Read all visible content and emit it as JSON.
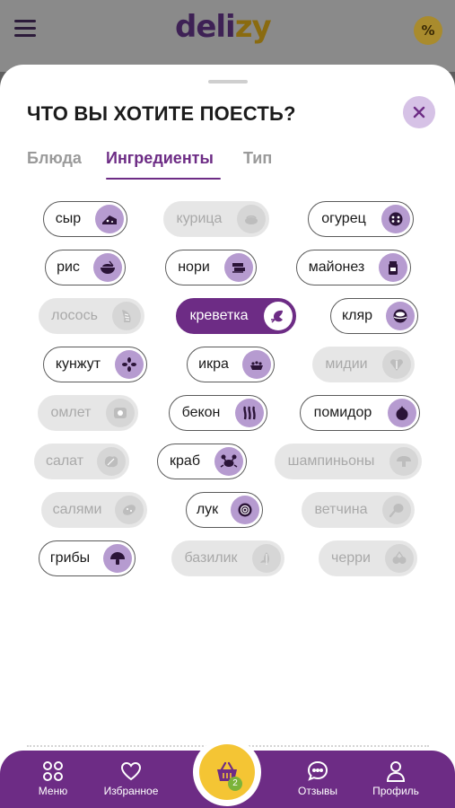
{
  "app": {
    "logo_part1": "deli",
    "logo_part2": "zy",
    "promo_badge": "%"
  },
  "sheet": {
    "title": "ЧТО ВЫ ХОТИТЕ ПОЕСТЬ?",
    "tabs": [
      {
        "label": "Блюда",
        "active": false
      },
      {
        "label": "Ингредиенты",
        "active": true
      },
      {
        "label": "Тип",
        "active": false
      }
    ],
    "ingredients": [
      {
        "label": "сыр",
        "state": "available",
        "icon": "cheese-icon"
      },
      {
        "label": "курица",
        "state": "disabled",
        "icon": "chicken-icon"
      },
      {
        "label": "огурец",
        "state": "available",
        "icon": "cucumber-icon"
      },
      {
        "label": "рис",
        "state": "available",
        "icon": "rice-bowl-icon"
      },
      {
        "label": "нори",
        "state": "available",
        "icon": "nori-icon"
      },
      {
        "label": "майонез",
        "state": "available",
        "icon": "mayo-jar-icon"
      },
      {
        "label": "лосось",
        "state": "disabled",
        "icon": "salmon-icon"
      },
      {
        "label": "креветка",
        "state": "selected",
        "icon": "shrimp-icon"
      },
      {
        "label": "кляр",
        "state": "available",
        "icon": "batter-icon"
      },
      {
        "label": "кунжут",
        "state": "available",
        "icon": "sesame-icon"
      },
      {
        "label": "икра",
        "state": "available",
        "icon": "caviar-icon"
      },
      {
        "label": "мидии",
        "state": "disabled",
        "icon": "mussels-icon"
      },
      {
        "label": "омлет",
        "state": "disabled",
        "icon": "omelette-icon"
      },
      {
        "label": "бекон",
        "state": "available",
        "icon": "bacon-icon"
      },
      {
        "label": "помидор",
        "state": "available",
        "icon": "tomato-icon"
      },
      {
        "label": "салат",
        "state": "disabled",
        "icon": "lettuce-icon"
      },
      {
        "label": "краб",
        "state": "available",
        "icon": "crab-icon"
      },
      {
        "label": "шампиньоны",
        "state": "disabled",
        "icon": "champignon-icon"
      },
      {
        "label": "салями",
        "state": "disabled",
        "icon": "salami-icon"
      },
      {
        "label": "лук",
        "state": "available",
        "icon": "onion-icon"
      },
      {
        "label": "ветчина",
        "state": "disabled",
        "icon": "ham-icon"
      },
      {
        "label": "грибы",
        "state": "available",
        "icon": "mushroom-icon"
      },
      {
        "label": "базилик",
        "state": "disabled",
        "icon": "basil-icon"
      },
      {
        "label": "черри",
        "state": "disabled",
        "icon": "cherry-tomato-icon"
      }
    ]
  },
  "nav": {
    "menu": "Меню",
    "favorites": "Избранное",
    "cart_count": "2",
    "reviews": "Отзывы",
    "profile": "Профиль"
  },
  "colors": {
    "accent": "#6d2c85",
    "chip_icon_bg": "#b69bd0",
    "cart": "#f4c534",
    "cart_badge": "#7bb33a"
  }
}
